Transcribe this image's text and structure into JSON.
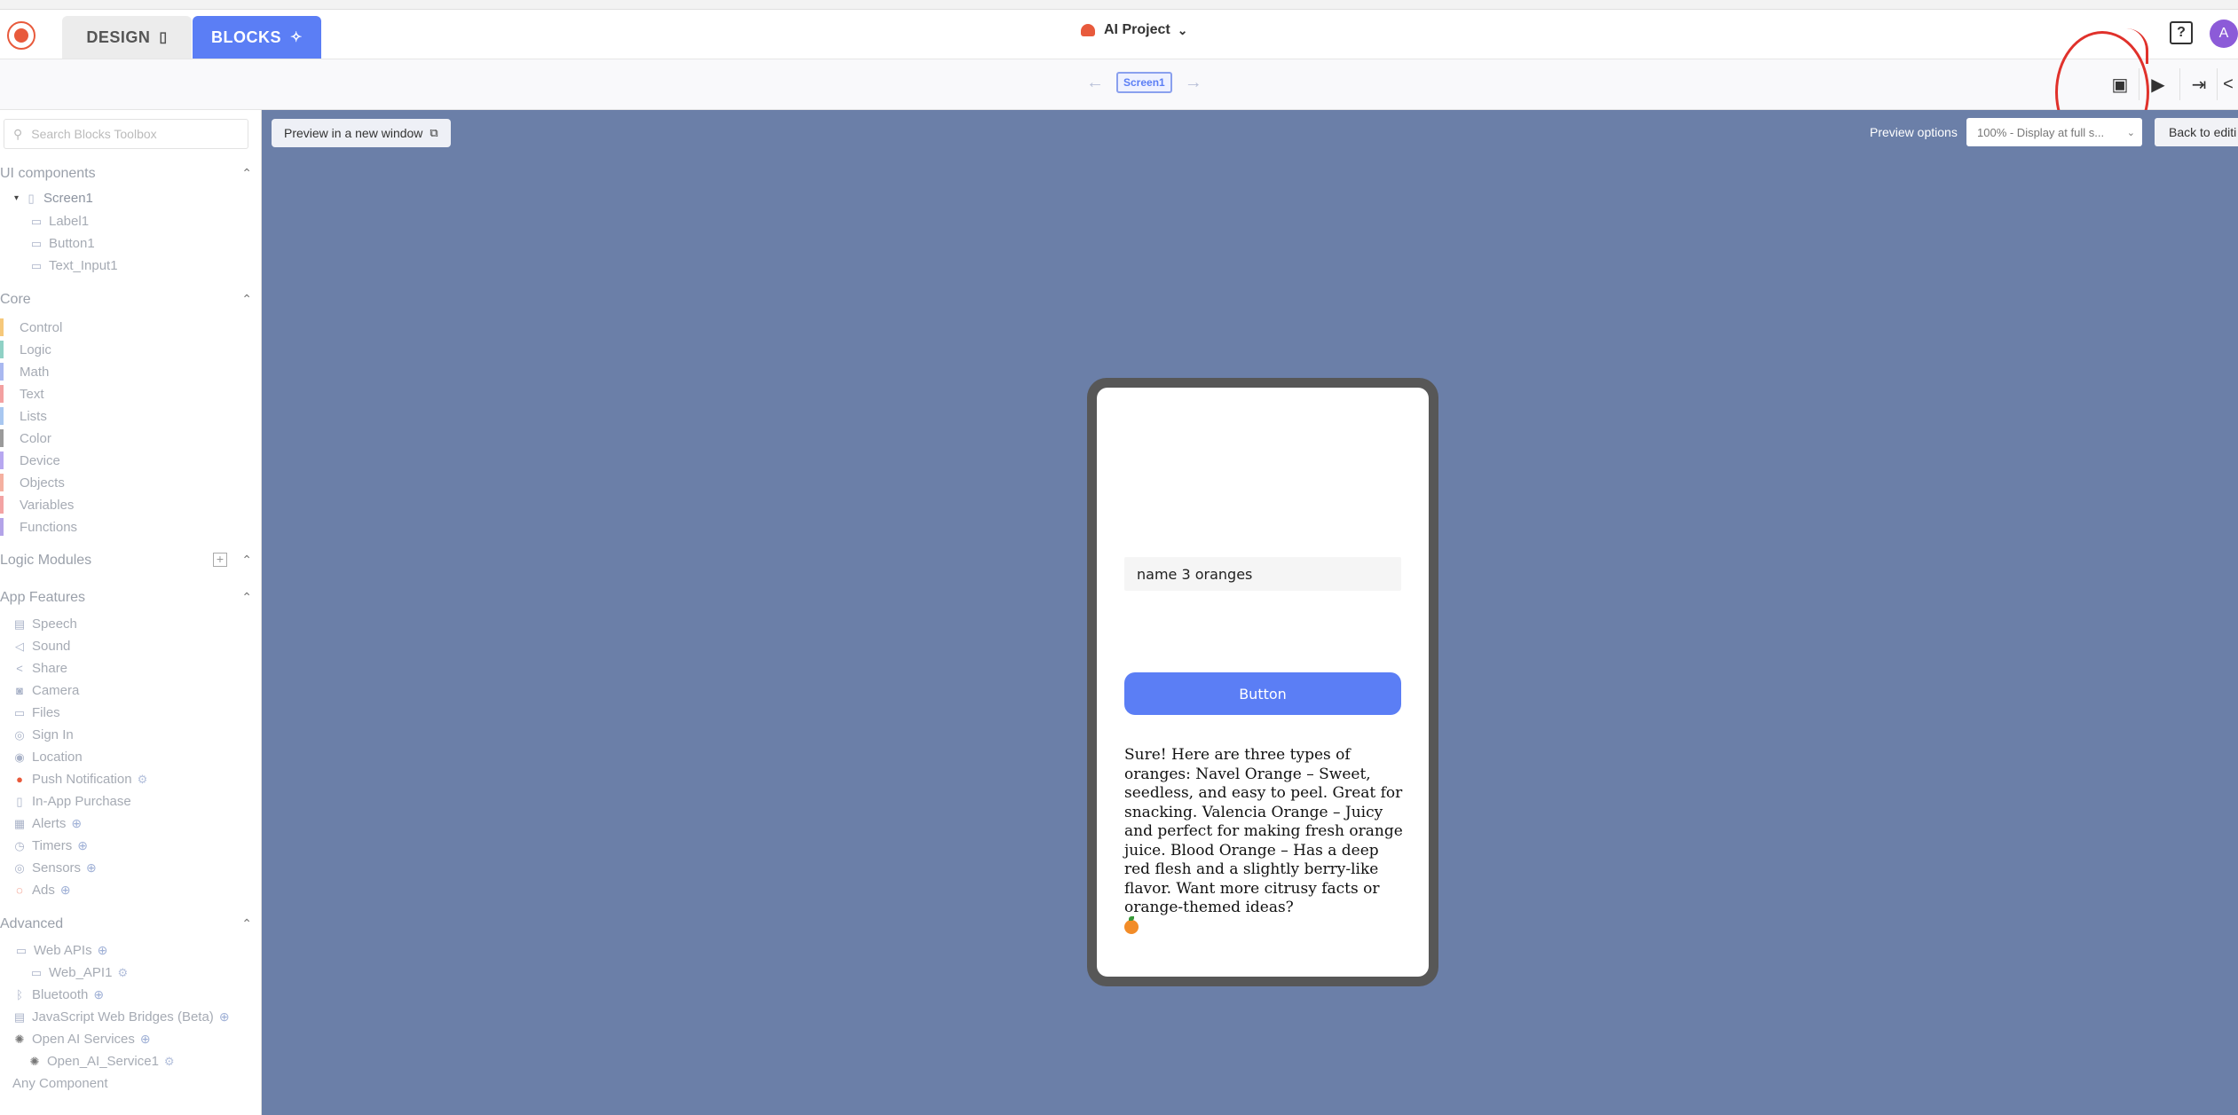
{
  "header": {
    "tabs": [
      {
        "label": "DESIGN",
        "icon": "phone-icon"
      },
      {
        "label": "BLOCKS",
        "icon": "puzzle-icon"
      }
    ],
    "project_name": "AI Project",
    "help_label": "?",
    "avatar_initial": "A"
  },
  "subbar": {
    "screen_name": "Screen1",
    "tools": [
      "preview-icon",
      "play-device-icon",
      "device-sync-icon",
      "share-icon"
    ]
  },
  "sidebar": {
    "search_placeholder": "Search Blocks Toolbox",
    "ui_components": {
      "title": "UI components",
      "screen": "Screen1",
      "children": [
        "Label1",
        "Button1",
        "Text_Input1"
      ]
    },
    "core": {
      "title": "Core",
      "items": [
        {
          "label": "Control",
          "color": "#f6c87a"
        },
        {
          "label": "Logic",
          "color": "#8fd1c5"
        },
        {
          "label": "Math",
          "color": "#a9b8f0"
        },
        {
          "label": "Text",
          "color": "#f3a0a0"
        },
        {
          "label": "Lists",
          "color": "#a8c7f0"
        },
        {
          "label": "Color",
          "color": "#9a9a9a"
        },
        {
          "label": "Device",
          "color": "#b7a7f0"
        },
        {
          "label": "Objects",
          "color": "#f5b0a0"
        },
        {
          "label": "Variables",
          "color": "#f3a3a3"
        },
        {
          "label": "Functions",
          "color": "#b3a3e8"
        }
      ]
    },
    "logic_modules": {
      "title": "Logic Modules"
    },
    "app_features": {
      "title": "App Features",
      "items": [
        "Speech",
        "Sound",
        "Share",
        "Camera",
        "Files",
        "Sign In",
        "Location",
        "Push Notification",
        "In-App Purchase",
        "Alerts",
        "Timers",
        "Sensors",
        "Ads"
      ]
    },
    "advanced": {
      "title": "Advanced",
      "items": [
        "Web APIs",
        "Web_API1",
        "Bluetooth",
        "JavaScript Web Bridges (Beta)",
        "Open AI Services",
        "Open_AI_Service1",
        "Any Component"
      ]
    }
  },
  "preview": {
    "new_window_label": "Preview in a new window",
    "options_label": "Preview options",
    "select_value": "100% - Display at full s...",
    "back_label": "Back to editi"
  },
  "app": {
    "input_value": "name 3 oranges",
    "button_label": "Button",
    "label_text": "Sure! Here are three types of oranges: Navel Orange – Sweet, seedless, and easy to peel. Great for snacking. Valencia Orange – Juicy and perfect for making fresh orange juice.  Blood Orange – Has a deep red flesh and a slightly berry-like flavor.  Want more citrusy facts or orange-themed ideas?"
  }
}
